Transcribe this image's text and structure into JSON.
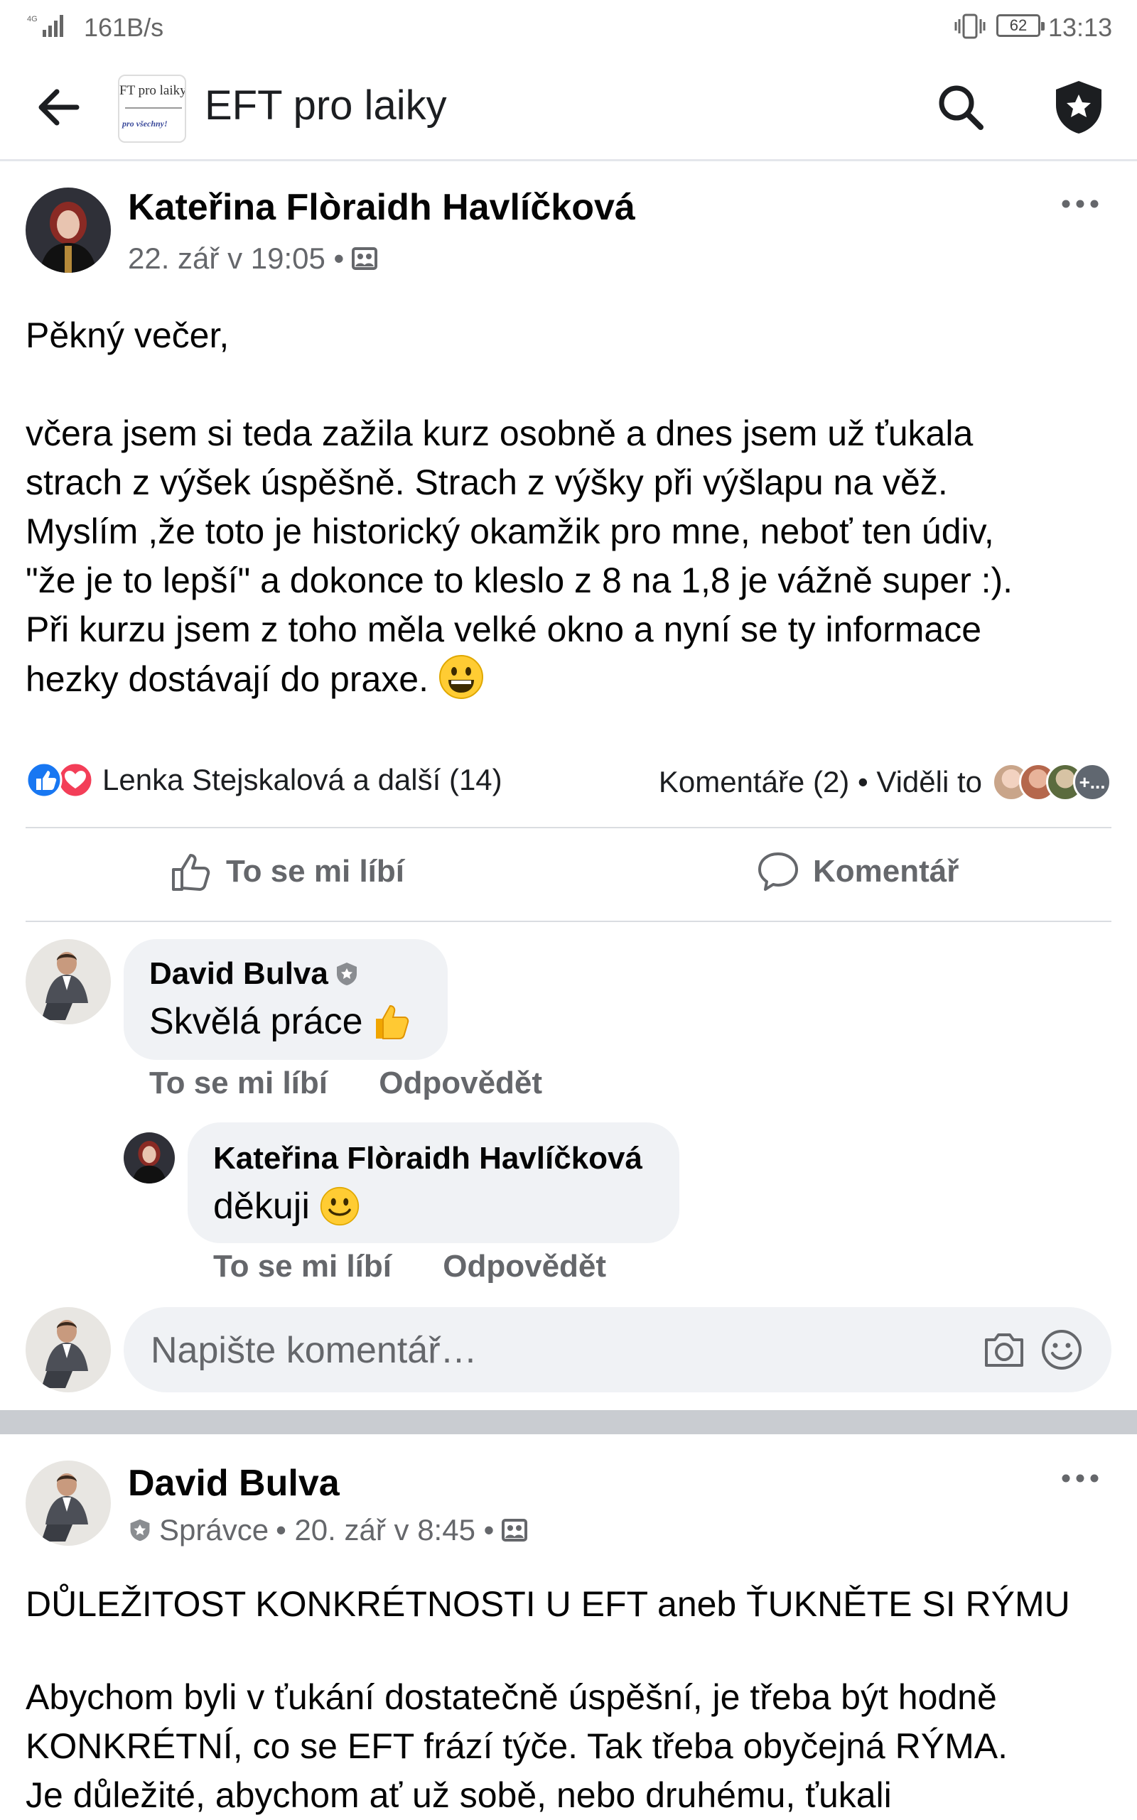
{
  "status_bar": {
    "network_speed": "161B/s",
    "battery": "62",
    "time": "13:13",
    "signal_label": "4G"
  },
  "app_bar": {
    "group_name": "EFT pro laiky",
    "logo_line1": "FT pro laiky",
    "logo_line2": "pro všechny!",
    "icons": [
      "back-arrow-icon",
      "search-icon",
      "admin-shield-icon"
    ]
  },
  "post1": {
    "author": "Kateřina Flòraidh Havlíčková",
    "timestamp": "22. zář v 19:05 •",
    "greeting": "Pěkný večer,",
    "lines": [
      "včera jsem si teda zažila kurz osobně a dnes jsem už ťukala",
      "strach z výšek úspěšně. Strach z výšky při výšlapu na věž.",
      "Myslím ,že toto je historický okamžik pro mne, neboť ten údiv,",
      "\"že je to lepší\" a dokonce to kleslo z 8 na 1,8 je vážně super :).",
      "Při kurzu jsem z toho měla velké okno a nyní se ty informace",
      "hezky dostávají do praxe."
    ],
    "reactions_text": "Lenka Stejskalová a další (14)",
    "comments_seen": "Komentáře (2) • Viděli to",
    "seen_more": "+...",
    "like_label": "To se mi líbí",
    "comment_label": "Komentář",
    "comments": [
      {
        "name": "David Bulva",
        "text": "Skvělá práce",
        "like": "To se mi líbí",
        "reply": "Odpovědět"
      },
      {
        "name": "Kateřina Flòraidh Havlíčková",
        "text": "děkuji",
        "like": "To se mi líbí",
        "reply": "Odpovědět"
      }
    ],
    "composer_placeholder": "Napište komentář…"
  },
  "post2": {
    "author": "David Bulva",
    "role": "Správce",
    "timestamp": "• 20. zář v 8:45 •",
    "headline": "DŮLEŽITOST KONKRÉTNOSTI U EFT aneb ŤUKNĚTE SI RÝMU",
    "lines": [
      "Abychom byli v ťukání dostatečně úspěšní, je třeba být hodně",
      "KONKRÉTNÍ, co se EFT frází týče. Tak třeba obyčejná RÝMA.",
      "Je důležité, abychom ať už sobě, nebo druhému, ťukali"
    ]
  },
  "colors": {
    "text": "#050505",
    "secondary": "#65676b",
    "bubble": "#f0f2f5",
    "like_blue": "#1877f2",
    "love_red": "#f33e58",
    "separator": "#c9ccd1"
  }
}
